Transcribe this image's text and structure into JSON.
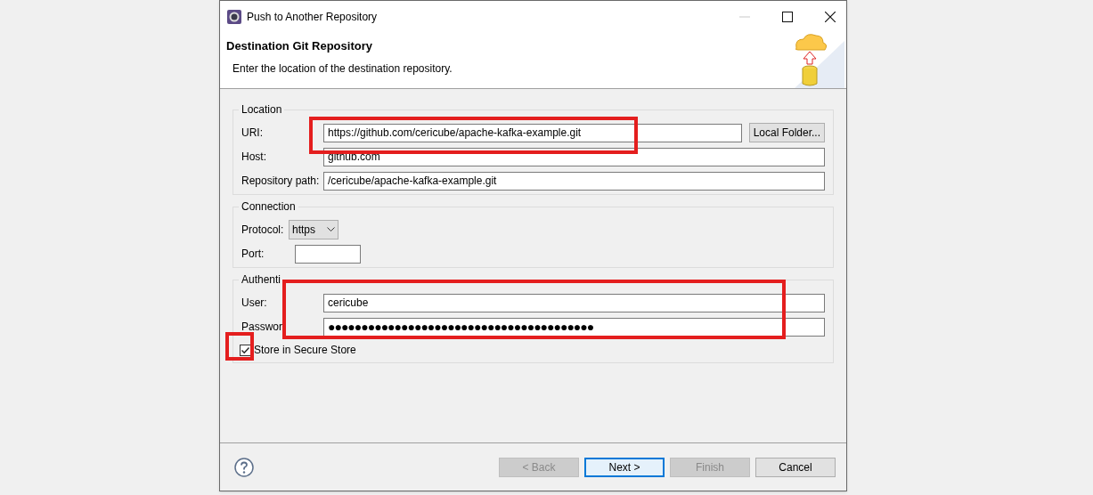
{
  "window": {
    "title": "Push to Another Repository"
  },
  "header": {
    "title": "Destination Git Repository",
    "description": "Enter the location of the destination repository."
  },
  "groups": [
    {
      "title": "Location",
      "fields": [
        {
          "kind": "text",
          "label": "URI:",
          "value": "https://github.com/cericube/apache-kafka-example.git",
          "button": "Local Folder..."
        },
        {
          "kind": "text",
          "label": "Host:",
          "value": "github.com"
        },
        {
          "kind": "text",
          "label": "Repository path:",
          "value": "/cericube/apache-kafka-example.git"
        }
      ]
    },
    {
      "title": "Connection",
      "fields": [
        {
          "kind": "combo",
          "label": "Protocol:",
          "value": "https"
        },
        {
          "kind": "short",
          "label": "Port:"
        }
      ]
    },
    {
      "title": "Authenti",
      "fields": [
        {
          "kind": "text",
          "label": "User:",
          "value": "cericube"
        },
        {
          "kind": "password",
          "label": "Passwor",
          "value": "●●●●●●●●●●●●●●●●●●●●●●●●●●●●●●●●●●●●●●●●"
        },
        {
          "kind": "checkbox",
          "label": "Store in Secure Store",
          "checked": true
        }
      ]
    }
  ],
  "buttons": [
    {
      "label": "< Back",
      "disabled": true,
      "selected": false
    },
    {
      "label": "Next >",
      "disabled": false,
      "selected": true
    },
    {
      "label": "Finish",
      "disabled": true,
      "selected": false
    },
    {
      "label": "Cancel",
      "disabled": false,
      "selected": false
    }
  ]
}
